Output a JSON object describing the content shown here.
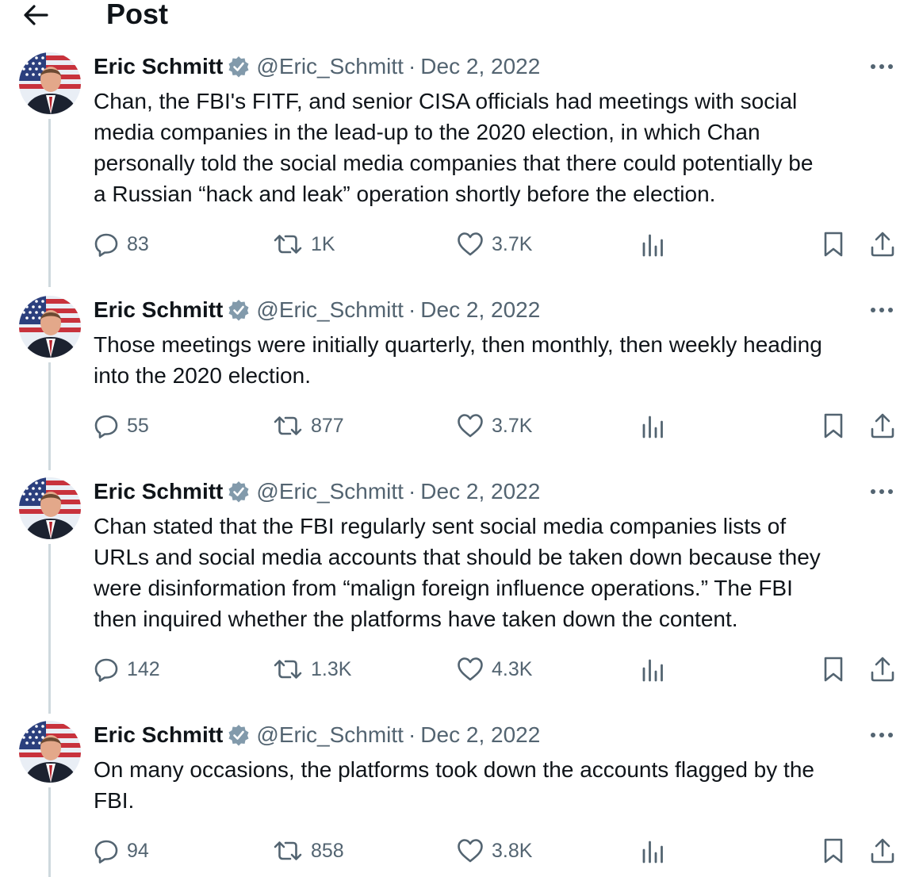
{
  "header": {
    "back_icon": "arrow-left-icon",
    "title": "Post"
  },
  "colors": {
    "text": "#0f1419",
    "secondary": "#536471",
    "verified": "#829aab",
    "thread_line": "#cfd9de"
  },
  "posts": [
    {
      "author": "Eric Schmitt",
      "handle": "@Eric_Schmitt",
      "separator": "·",
      "date": "Dec 2, 2022",
      "text": "Chan, the FBI's FITF, and senior CISA officials had meetings with social\nmedia companies in the lead-up to the 2020 election, in which Chan\npersonally told the social media companies that there could potentially be\na Russian “hack and leak” operation shortly before the election.",
      "replies": "83",
      "reposts": "1K",
      "likes": "3.7K"
    },
    {
      "author": "Eric Schmitt",
      "handle": "@Eric_Schmitt",
      "separator": "·",
      "date": "Dec 2, 2022",
      "text": "Those meetings were initially quarterly, then monthly, then weekly heading\ninto the 2020 election.",
      "replies": "55",
      "reposts": "877",
      "likes": "3.7K"
    },
    {
      "author": "Eric Schmitt",
      "handle": "@Eric_Schmitt",
      "separator": "·",
      "date": "Dec 2, 2022",
      "text": "Chan stated that the FBI regularly sent social media companies lists of\nURLs and social media accounts that should be taken down because they\nwere disinformation from “malign foreign influence operations.” The FBI\nthen inquired whether the platforms have taken down the content.",
      "replies": "142",
      "reposts": "1.3K",
      "likes": "4.3K"
    },
    {
      "author": "Eric Schmitt",
      "handle": "@Eric_Schmitt",
      "separator": "·",
      "date": "Dec 2, 2022",
      "text": "On many occasions, the platforms took down the accounts flagged by the\nFBI.",
      "replies": "94",
      "reposts": "858",
      "likes": "3.8K"
    }
  ]
}
